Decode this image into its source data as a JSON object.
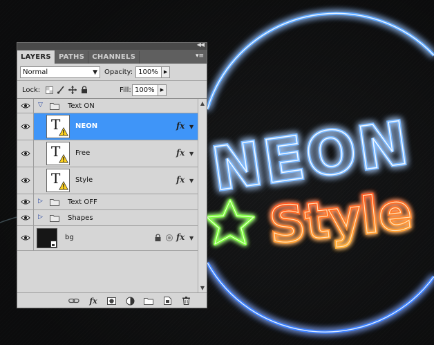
{
  "artwork": {
    "line1": "NEON",
    "line2": "Style",
    "colors": {
      "blue_glow": "#2f8cff",
      "orange_text": "#ff7a1a",
      "star_green": "#7dff3c"
    }
  },
  "panel": {
    "tabs": [
      {
        "label": "LAYERS",
        "active": true
      },
      {
        "label": "PATHS",
        "active": false
      },
      {
        "label": "CHANNELS",
        "active": false
      }
    ],
    "blend_mode": "Normal",
    "opacity_label": "Opacity:",
    "opacity_value": "100%",
    "lock_label": "Lock:",
    "fill_label": "Fill:",
    "fill_value": "100%"
  },
  "layers": [
    {
      "name": "Text ON",
      "type": "group",
      "expanded": true
    },
    {
      "name": "NEON",
      "type": "text",
      "selected": true,
      "fx": "fx"
    },
    {
      "name": "Free",
      "type": "text",
      "fx": "fx"
    },
    {
      "name": "Style",
      "type": "text",
      "fx": "fx"
    },
    {
      "name": "Text OFF",
      "type": "group",
      "expanded": false
    },
    {
      "name": "Shapes",
      "type": "group",
      "expanded": false
    },
    {
      "name": "bg",
      "type": "raster",
      "locked": true,
      "fx": "fx"
    }
  ],
  "footer": {
    "fx_label": "fx"
  },
  "ui_colors": {
    "selection": "#3f95f8",
    "panel_bg": "#d6d6d6",
    "tab_bar": "#5f5f5f"
  }
}
